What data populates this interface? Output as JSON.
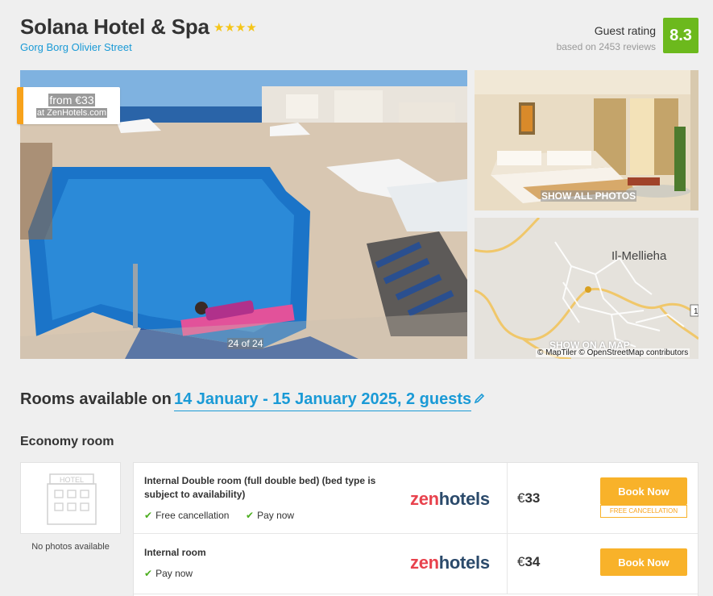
{
  "hotel": {
    "name": "Solana Hotel & Spa",
    "stars": "★★★★",
    "star_count": 4,
    "address": "Gorg Borg Olivier Street"
  },
  "rating": {
    "label": "Guest rating",
    "reviews": "based on 2453 reviews",
    "score": "8.3"
  },
  "gallery": {
    "price_from": "from €33",
    "price_source": "at ZenHotels.com",
    "counter": "24 of 24",
    "show_all": "SHOW ALL PHOTOS",
    "show_map": "SHOW ON A MAP",
    "map_credit": "© MapTiler © OpenStreetMap contributors",
    "map_place": "Il-Mellieha"
  },
  "rooms": {
    "heading": "Rooms available on",
    "dates": "14 January - 15 January 2025, 2 guests",
    "room_type": "Economy room",
    "no_photos": "No photos available",
    "hotel_sign": "HOTEL"
  },
  "offers": [
    {
      "name": "Internal Double room (full double bed) (bed type is subject to availability)",
      "features": [
        "Free cancellation",
        "Pay now"
      ],
      "provider_a": "zen",
      "provider_b": "hotels",
      "currency": "€",
      "price": "33",
      "book": "Book Now",
      "cancel_note": "FREE CANCELLATION"
    },
    {
      "name": "Internal room",
      "features": [
        "Pay now"
      ],
      "provider_a": "zen",
      "provider_b": "hotels",
      "currency": "€",
      "price": "34",
      "book": "Book Now"
    }
  ],
  "colors": {
    "accent": "#1a9ad6",
    "rating_green": "#6cb91d",
    "button_orange": "#f8b22a",
    "check_green": "#4cae1f"
  }
}
